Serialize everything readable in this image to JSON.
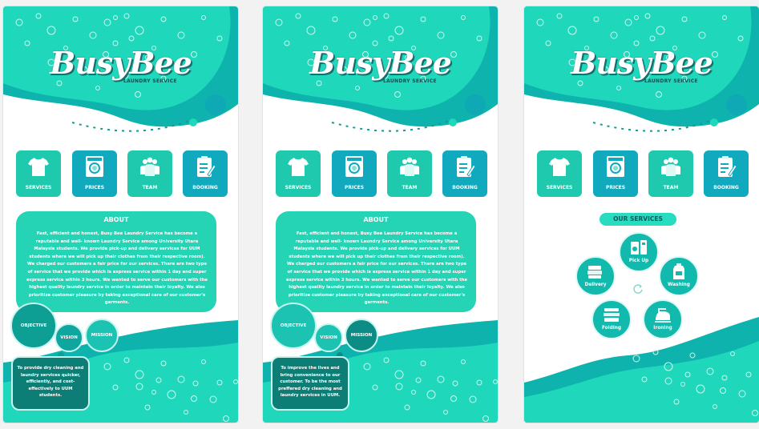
{
  "app": {
    "logo_main": "BusyBee",
    "logo_sub": "LAUNDRY SERVICE"
  },
  "nav": [
    {
      "label": "SERVICES",
      "icon": "tshirt-icon",
      "color": "#1fc9ad"
    },
    {
      "label": "PRICES",
      "icon": "washing-machine-icon",
      "color": "#11a9bd"
    },
    {
      "label": "TEAM",
      "icon": "team-icon",
      "color": "#1fc9ad"
    },
    {
      "label": "BOOKING",
      "icon": "clipboard-icon",
      "color": "#11a9bd"
    }
  ],
  "about": {
    "title": "ABOUT",
    "text": "Fast, efficient and honest, Busy Bee Laundry Service has become a reputable and well- known Laundry Service among University Utara Malaysia students. We provide pick-up and delivery services for UUM students where we will pick up their clothes from their respective room). We charged our customers a fair price for our services. There are two type of service that we provide which is express service within 1 day and super express service within 3 hours. We wanted to serve our customers with the highest quality laundry service in order to maintain their loyalty. We also prioritize customer pleasure by taking exceptional care of our customer's garments."
  },
  "bubbles": {
    "objective": "OBJECTIVE",
    "vision": "VISION",
    "mission": "MISSION"
  },
  "screens": [
    {
      "selected": "objective",
      "statement": "To provide dry cleaning and laundry services quicker, efficiently, and cost- effectively to UUM students."
    },
    {
      "selected": "mission",
      "statement": "To improve the lives and bring convenience to our customer. To be the most preffered dry cleaning and laundry services in UUM."
    }
  ],
  "services": {
    "title": "OUR SERVICES",
    "items": [
      {
        "label": "Pick Up",
        "icon": "pickup-icon"
      },
      {
        "label": "Washing",
        "icon": "detergent-icon"
      },
      {
        "label": "Ironing",
        "icon": "iron-icon"
      },
      {
        "label": "Folding",
        "icon": "folded-clothes-icon"
      },
      {
        "label": "Delivery",
        "icon": "delivery-icon"
      }
    ]
  },
  "colors": {
    "primary": "#1fd4b8",
    "teal_dark": "#0d7e76",
    "accent": "#11a9bd"
  }
}
